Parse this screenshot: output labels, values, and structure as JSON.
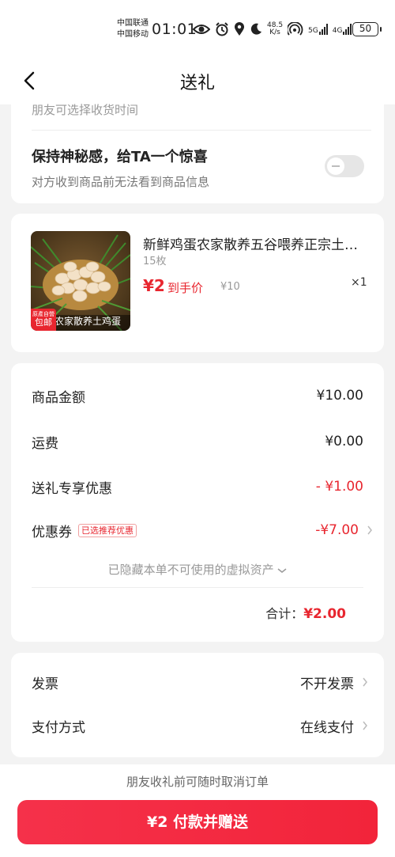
{
  "status_bar": {
    "carrier_1": "中国联通",
    "carrier_2": "中国移动",
    "time": "01:01",
    "net_speed_value": "48.5",
    "net_speed_unit": "K/s",
    "signal_1": "5G",
    "signal_2": "4G",
    "battery": "50"
  },
  "nav": {
    "title": "送礼"
  },
  "gift_settings": {
    "receive_time_text": "朋友可选择收货时间",
    "surprise_title": "保持神秘感，给TA一个惊喜",
    "surprise_subtitle": "对方收到商品前无法看到商品信息",
    "surprise_enabled": false
  },
  "product": {
    "title": "新鲜鸡蛋农家散养五谷喂养正宗土鸡蛋",
    "spec": "15枚",
    "price": "¥2",
    "price_label": "到手价",
    "original_price": "¥10",
    "quantity": "×1",
    "image_caption": "农家散养土鸡蛋",
    "tag_top": "原產自營",
    "tag_main": "包邮"
  },
  "summary": {
    "goods_amount_label": "商品金额",
    "goods_amount": "¥10.00",
    "shipping_label": "运费",
    "shipping": "¥0.00",
    "gift_discount_label": "送礼专享优惠",
    "gift_discount": "- ¥1.00",
    "coupon_label": "优惠券",
    "coupon_badge": "已选推荐优惠",
    "coupon_value": "-¥7.00",
    "hidden_assets_text": "已隐藏本单不可使用的虚拟资产",
    "total_label": "合计：",
    "total_value": "¥2.00"
  },
  "order_options": {
    "invoice_label": "发票",
    "invoice_value": "不开发票",
    "payment_label": "支付方式",
    "payment_value": "在线支付"
  },
  "footer": {
    "note": "朋友收礼前可随时取消订单",
    "pay_button": "¥2 付款并赠送"
  },
  "colors": {
    "accent": "#e8262f",
    "button": "#f2243a",
    "background": "#f3f3f3"
  }
}
